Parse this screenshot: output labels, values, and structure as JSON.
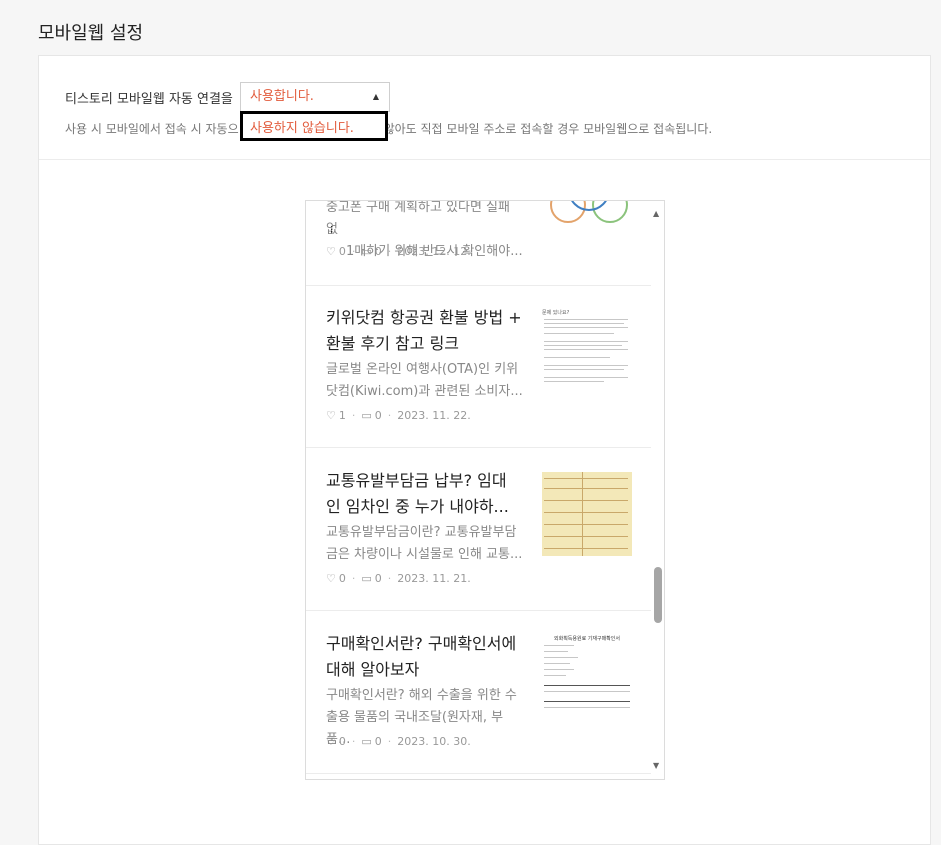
{
  "page": {
    "title": "모바일웹 설정"
  },
  "setting": {
    "label": "티스토리 모바일웹 자동 연결을",
    "selected": "사용합니다.",
    "dropdown_option": "사용하지 않습니다.",
    "help_left": "사용 시 모바일에서 접속 시 자동으",
    "help_right": "용하지 않아도 직접 모바일 주소로 접속할 경우 모바일웹으로 접속됩니다."
  },
  "colors": {
    "accent": "#e25c3d"
  },
  "posts": [
    {
      "title": "",
      "summary_1": "중고폰 구매 계획하고 있다면 실패 없",
      "summary_2": "1매하기 위해 반드시 확인해야...",
      "likes": "0",
      "comments": "0",
      "date": "2023. 12. 12."
    },
    {
      "title_1": "키위닷컴 항공권 환불 방법 +",
      "title_2": "환불 후기 참고 링크",
      "summary_1": "글로벌 온라인 여행사(OTA)인 키위",
      "summary_2": "닷컴(Kiwi.com)과 관련된 소비자...",
      "likes": "1",
      "comments": "0",
      "date": "2023. 11. 22.",
      "thumb_heading": "문제 있나요?"
    },
    {
      "title_1": "교통유발부담금 납부? 임대",
      "title_2": "인 임차인 중 누가 내야하...",
      "summary_1": "교통유발부담금이란? 교통유발부담",
      "summary_2": "금은 차량이나 시설물로 인해 교통...",
      "likes": "0",
      "comments": "0",
      "date": "2023. 11. 21."
    },
    {
      "title_1": "구매확인서란? 구매확인서에",
      "title_2": "대해 알아보자",
      "summary_1": "구매확인서란? 해외 수출을 위한 수",
      "summary_2": "출용 물품의 국내조달(원자재, 부품...",
      "likes": "0",
      "comments": "0",
      "date": "2023. 10. 30.",
      "thumb_heading": "외화획득용원료 기재구매확인서"
    }
  ]
}
